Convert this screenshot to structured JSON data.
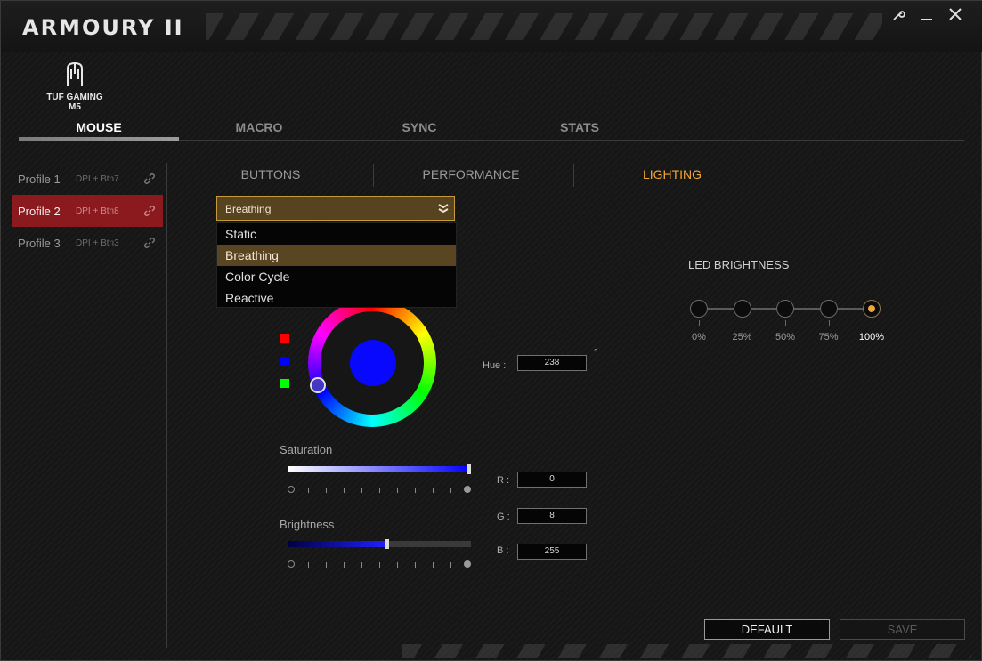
{
  "app": {
    "title": "ARMOURY II",
    "device_line1": "TUF GAMING",
    "device_line2": "M5"
  },
  "window": {
    "settings_icon": "wrench-icon",
    "minimize_icon": "minimize-icon",
    "close_icon": "close-icon"
  },
  "main_tabs": [
    {
      "label": "MOUSE",
      "active": true
    },
    {
      "label": "MACRO"
    },
    {
      "label": "SYNC"
    },
    {
      "label": "STATS"
    }
  ],
  "profiles": [
    {
      "name": "Profile 1",
      "binding": "DPI + Btn7"
    },
    {
      "name": "Profile 2",
      "binding": "DPI + Btn8",
      "active": true
    },
    {
      "name": "Profile 3",
      "binding": "DPI + Btn3"
    }
  ],
  "sub_tabs": [
    {
      "label": "BUTTONS"
    },
    {
      "label": "PERFORMANCE"
    },
    {
      "label": "LIGHTING",
      "active": true
    }
  ],
  "effect": {
    "selected": "Breathing",
    "options": [
      "Static",
      "Breathing",
      "Color Cycle",
      "Reactive"
    ]
  },
  "color": {
    "swatches": [
      "#ff0000",
      "#0000ff",
      "#00ff00"
    ],
    "current": "#0808ff",
    "hue_label": "Hue :",
    "hue": "238",
    "degree": "°",
    "r_label": "R :",
    "g_label": "G :",
    "b_label": "B :",
    "r": "0",
    "g": "8",
    "b": "255"
  },
  "saturation": {
    "label": "Saturation",
    "value_fraction": 1.0
  },
  "brightness": {
    "label": "Brightness",
    "value_fraction": 0.54
  },
  "led_brightness": {
    "title": "LED BRIGHTNESS",
    "levels": [
      "0%",
      "25%",
      "50%",
      "75%",
      "100%"
    ],
    "selected_index": 4
  },
  "buttons": {
    "default": "DEFAULT",
    "save": "SAVE"
  },
  "accent": "#f2a634",
  "profile_active_color": "#8b1a1f"
}
